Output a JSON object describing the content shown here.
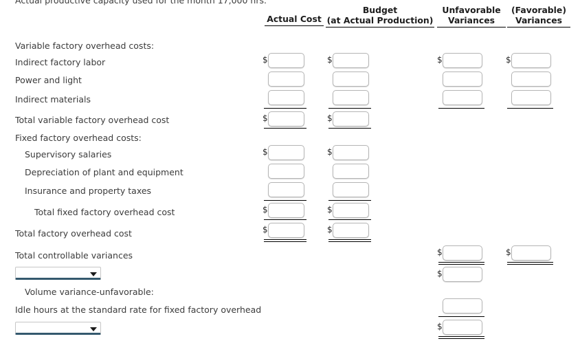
{
  "intro": {
    "line": "Actual productive capacity used for the month 17,000 hrs."
  },
  "headers": {
    "actual_cost": "Actual Cost",
    "budget_line1": "Budget",
    "budget_line2": "(at Actual Production)",
    "unfavorable_line1": "Unfavorable",
    "unfavorable_line2": "Variances",
    "favorable_line1": "(Favorable)",
    "favorable_line2": "Variances"
  },
  "rows": {
    "variable_section": "Variable factory overhead costs:",
    "indirect_factory_labor": "Indirect factory labor",
    "power_and_light": "Power and light",
    "indirect_materials": "Indirect materials",
    "total_variable": "Total variable factory overhead cost",
    "fixed_section": "Fixed factory overhead costs:",
    "supervisory_salaries": "Supervisory salaries",
    "depreciation": "Depreciation of plant and equipment",
    "insurance_taxes": "Insurance and property taxes",
    "total_fixed": "Total fixed factory overhead cost",
    "total_factory_overhead": "Total factory overhead cost",
    "total_controllable": "Total controllable variances",
    "volume_variance_heading": "Volume variance-unfavorable:",
    "idle_hours": "Idle hours at the standard rate for fixed factory overhead"
  },
  "currency_symbol": "$",
  "inputs": {
    "value": "",
    "placeholder": ""
  },
  "dropdowns": {
    "selected_1": "",
    "selected_2": ""
  },
  "colors": {
    "text": "#3b3b3b",
    "header_text": "#1d1d1d",
    "rule": "#000000",
    "input_border": "#b4b4b4",
    "dropdown_accent": "#34596e"
  }
}
